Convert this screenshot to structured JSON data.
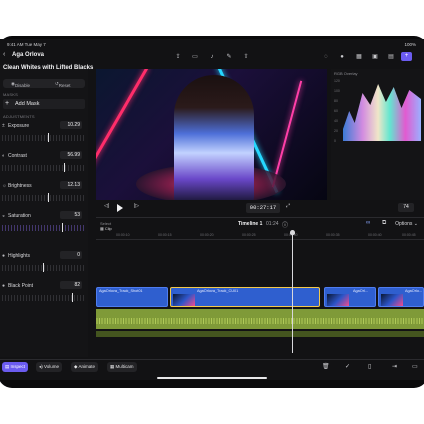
{
  "status": {
    "time": "9:41 AM  Tue May 7",
    "battery": "100%"
  },
  "header": {
    "back_icon": "chevron-left",
    "project": "Aga Orlova",
    "toolbar_icons": [
      "share",
      "camera",
      "mic",
      "pencil",
      "export",
      "circle",
      "stroke",
      "grid",
      "photo",
      "browser",
      "plus"
    ]
  },
  "inspector": {
    "title": "Clean Whites with Lifted Blacks",
    "toggle_disable": "Disable",
    "toggle_reset": "Reset",
    "masks_header": "MASKS",
    "add_mask": "Add Mask",
    "adjustments_header": "ADJUSTMENTS",
    "params": [
      {
        "label": "Exposure",
        "value": "10.29"
      },
      {
        "label": "Contrast",
        "value": "56.99"
      },
      {
        "label": "Brightness",
        "value": "12.13"
      },
      {
        "label": "Saturation",
        "value": "53"
      },
      {
        "label": "Highlights",
        "value": "0"
      },
      {
        "label": "Black Point",
        "value": "82"
      }
    ]
  },
  "scopes": {
    "label": "RGB Overlay",
    "scale": [
      "120",
      "100",
      "80",
      "60",
      "40",
      "20",
      "0"
    ]
  },
  "transport": {
    "timecode": "00:27:17",
    "zoom": "74"
  },
  "timeline": {
    "select_label": "Select",
    "clip_label": "Clip",
    "name": "Timeline 1",
    "duration": "01:24",
    "options": "Options",
    "ruler": [
      "00:00:10",
      "00:00:15",
      "00:00:20",
      "00:00:25",
      "00:00:30",
      "00:00:35",
      "00:00:40",
      "00:00:45"
    ],
    "clips": [
      "AgaOrlova_Track_Shot01",
      "AgaOrlova_Track_CU01",
      "AgaOrl...",
      "AgaOrlo..."
    ]
  },
  "bottom": {
    "inspect": "Inspect",
    "volume": "Volume",
    "animate": "Animate",
    "multicam": "Multicam"
  },
  "colors": {
    "accent": "#6b5cf0",
    "clip_blue": "#2f5fcf",
    "audio_green": "#7f9a38"
  }
}
